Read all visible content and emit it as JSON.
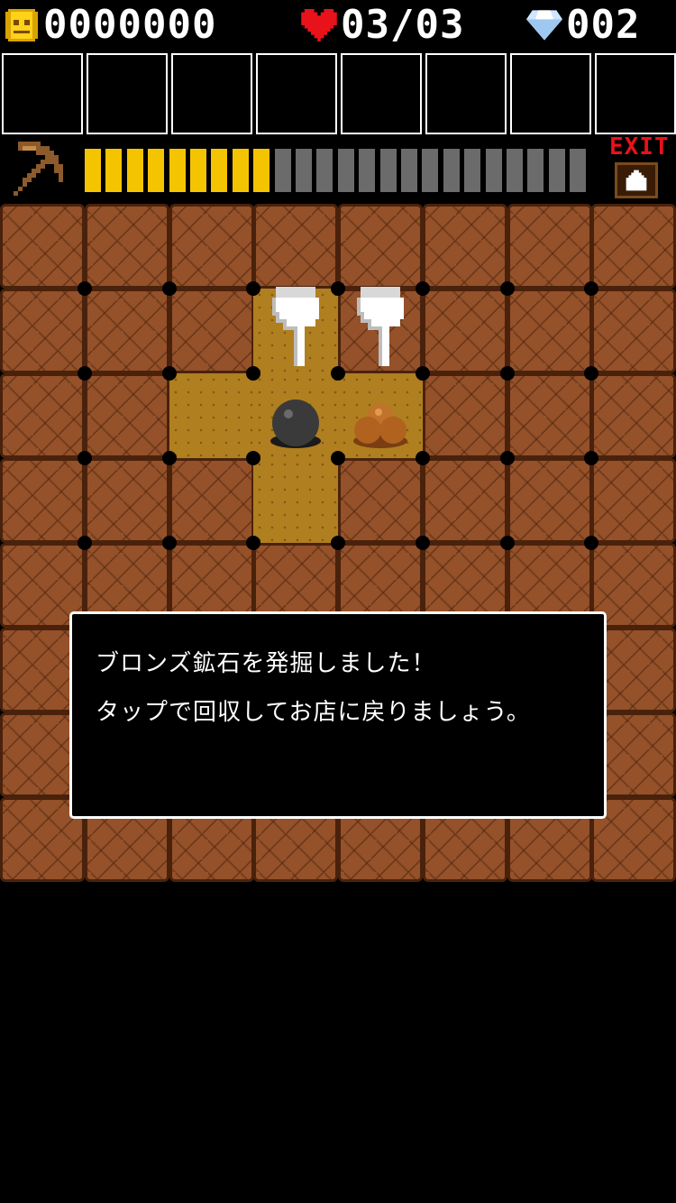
{
  "status": {
    "coins": "0000000",
    "hearts": "03/03",
    "gems": "002",
    "coin_icon": "coin-icon",
    "heart_icon": "heart-icon",
    "gem_icon": "diamond-icon"
  },
  "inventory": {
    "slots": 8,
    "items": []
  },
  "tool": {
    "icon": "pickaxe-icon",
    "stamina_filled": 9,
    "stamina_total": 24
  },
  "exit": {
    "label": "EXIT"
  },
  "board": {
    "columns": 8,
    "rows": 8,
    "dug_cells": [
      [
        3,
        1
      ],
      [
        2,
        2
      ],
      [
        3,
        2
      ],
      [
        4,
        2
      ],
      [
        3,
        3
      ]
    ],
    "items": [
      {
        "name": "iron-ore-ball",
        "cell": [
          3,
          2
        ],
        "color": "#3a3a3a"
      },
      {
        "name": "bronze-ore",
        "cell": [
          4,
          2
        ],
        "color": "#b0621e"
      }
    ],
    "pointers": [
      {
        "name": "tap-hint-pointer",
        "cell": [
          3,
          1
        ]
      },
      {
        "name": "tap-hint-pointer",
        "cell": [
          4,
          1
        ]
      }
    ]
  },
  "dialog": {
    "line1": "ブロンズ鉱石を発掘しました！",
    "line2": "タップで回収してお店に戻りましょう。"
  },
  "colors": {
    "stamina_full": "#f5c400",
    "stamina_empty": "#6b6b6b",
    "dirt": "#94512a",
    "dug": "#b07f1f",
    "exit_text": "#e8121a"
  }
}
